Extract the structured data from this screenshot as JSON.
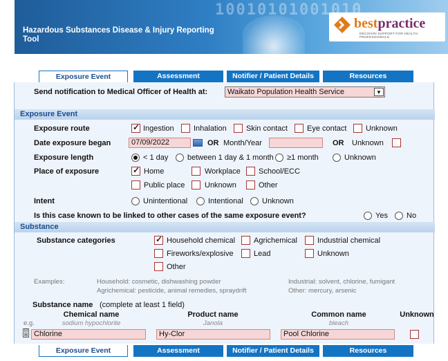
{
  "header": {
    "title": "Hazardous Substances Disease & Injury Reporting Tool",
    "logo_brand_a": "best",
    "logo_brand_b": "practice",
    "logo_tagline": "DECISION SUPPORT FOR HEALTH PROFESSIONALS",
    "digits": "10010101001010"
  },
  "tabs": [
    "Exposure Event",
    "Assessment",
    "Notifier / Patient Details",
    "Resources"
  ],
  "active_tab": "Exposure Event",
  "notification": {
    "label": "Send notification to Medical Officer of Health at:",
    "value": "Waikato Population Health Service"
  },
  "exposure": {
    "section_title": "Exposure Event",
    "route_label": "Exposure route",
    "routes": [
      {
        "label": "Ingestion",
        "checked": true
      },
      {
        "label": "Inhalation",
        "checked": false
      },
      {
        "label": "Skin contact",
        "checked": false
      },
      {
        "label": "Eye contact",
        "checked": false
      },
      {
        "label": "Unknown",
        "checked": false
      }
    ],
    "date_label": "Date exposure began",
    "date_value": "07/09/2022",
    "or1": "OR",
    "month_year_label": "Month/Year",
    "or2": "OR",
    "unknown_label": "Unknown",
    "length_label": "Exposure length",
    "lengths": [
      {
        "label": "< 1 day",
        "checked": true
      },
      {
        "label": "between 1 day & 1 month",
        "checked": false
      },
      {
        "label": "≥1 month",
        "checked": false
      },
      {
        "label": "Unknown",
        "checked": false
      }
    ],
    "place_label": "Place of exposure",
    "places": [
      {
        "label": "Home",
        "checked": true
      },
      {
        "label": "Workplace",
        "checked": false
      },
      {
        "label": "School/ECC",
        "checked": false
      },
      {
        "label": "Public place",
        "checked": false
      },
      {
        "label": "Unknown",
        "checked": false
      },
      {
        "label": "Other",
        "checked": false
      }
    ],
    "intent_label": "Intent",
    "intents": [
      {
        "label": "Unintentional",
        "checked": false
      },
      {
        "label": "Intentional",
        "checked": false
      },
      {
        "label": "Unknown",
        "checked": false
      }
    ],
    "linked_question": "Is this case known to be linked to other cases of the same exposure event?",
    "linked_options": [
      {
        "label": "Yes",
        "checked": false
      },
      {
        "label": "No",
        "checked": false
      }
    ]
  },
  "substance": {
    "section_title": "Substance",
    "categories_label": "Substance categories",
    "categories": [
      {
        "label": "Household chemical",
        "checked": true
      },
      {
        "label": "Agrichemical",
        "checked": false
      },
      {
        "label": "Industrial chemical",
        "checked": false
      },
      {
        "label": "Fireworks/explosive",
        "checked": false
      },
      {
        "label": "Lead",
        "checked": false
      },
      {
        "label": "Unknown",
        "checked": false
      },
      {
        "label": "Other",
        "checked": false
      }
    ],
    "examples_label": "Examples:",
    "examples": {
      "household": "Household: cosmetic, dishwashing powder",
      "agrichemical": "Agrichemical: pesticide, animal remedies, spraydrift",
      "industrial": "Industrial: solvent, chlorine, fumigant",
      "other": "Other: mercury, arsenic"
    },
    "name_label": "Substance name",
    "name_hint": "(complete at least 1 field)",
    "columns": {
      "chemical": "Chemical name",
      "product": "Product name",
      "common": "Common name",
      "unknown": "Unknown"
    },
    "eg_label": "e.g.",
    "eg": {
      "chemical": "sodium hypochlorite",
      "product": "Janola",
      "common": "bleach"
    },
    "row": {
      "chemical": "Chlorine",
      "product": "Hy-Clor",
      "common": "Pool Chlorine"
    }
  },
  "colors": {
    "tab_blue": "#1474c4",
    "section_text": "#1a4c8c",
    "input_pink": "#f6d6d6"
  }
}
